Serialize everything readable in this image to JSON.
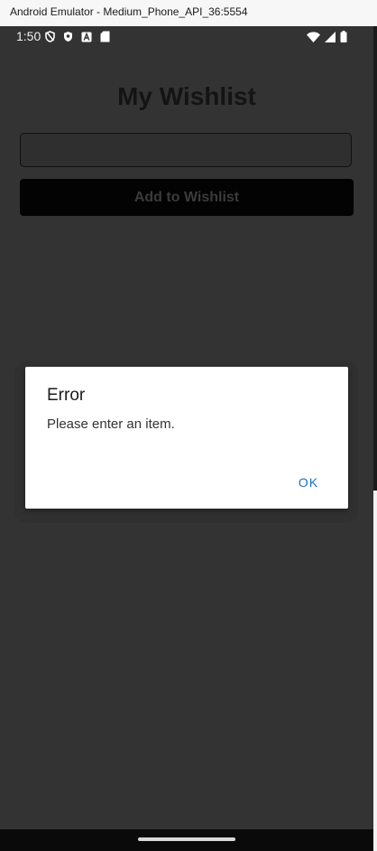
{
  "window": {
    "title": "Android Emulator - Medium_Phone_API_36:5554"
  },
  "statusbar": {
    "time": "1:50",
    "left_icons": [
      "shield-outline-icon",
      "shield-solid-icon",
      "a-icon",
      "sd-card-icon"
    ],
    "right_icons": [
      "wifi-icon",
      "signal-icon",
      "battery-icon"
    ]
  },
  "app": {
    "title": "My Wishlist",
    "input": {
      "value": "",
      "placeholder": ""
    },
    "add_button_label": "Add to Wishlist"
  },
  "dialog": {
    "title": "Error",
    "message": "Please enter an item.",
    "ok_label": "OK"
  },
  "colors": {
    "background": "#333333",
    "button": "#030303",
    "dialog_accent": "#1a6fc4"
  }
}
